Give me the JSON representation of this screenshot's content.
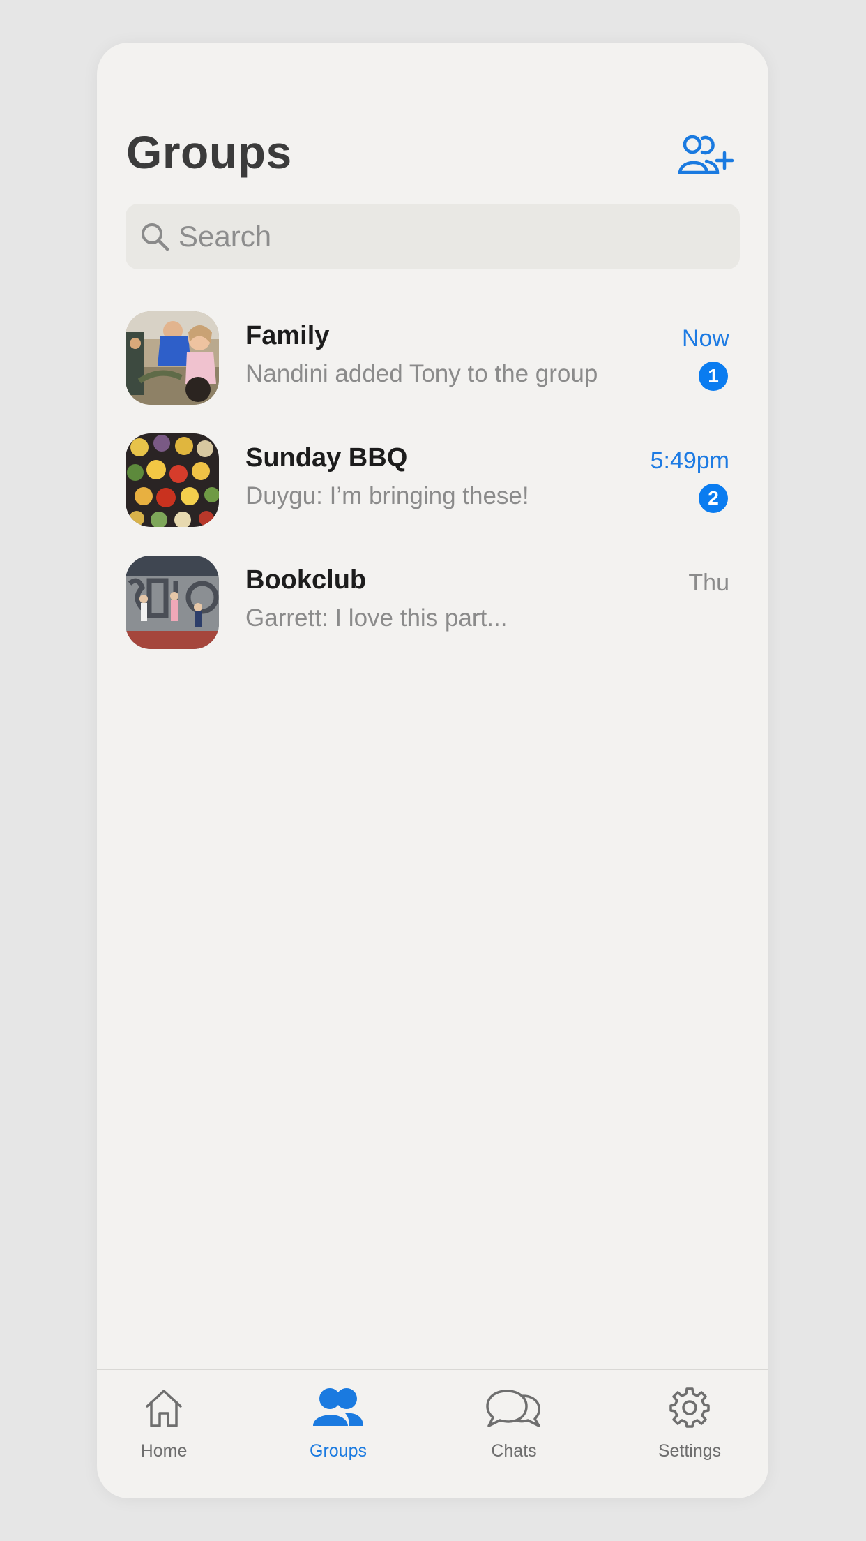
{
  "header": {
    "title": "Groups"
  },
  "search": {
    "placeholder": "Search"
  },
  "groups": [
    {
      "name": "Family",
      "preview": "Nandini added Tony to the group",
      "time": "Now",
      "unread": "1"
    },
    {
      "name": "Sunday BBQ",
      "preview": "Duygu: I’m bringing these!",
      "time": "5:49pm",
      "unread": "2"
    },
    {
      "name": "Bookclub",
      "preview": "Garrett: I love this part...",
      "time": "Thu"
    }
  ],
  "tabs": [
    {
      "label": "Home",
      "icon": "house-icon"
    },
    {
      "label": "Groups",
      "icon": "people-icon",
      "active": true
    },
    {
      "label": "Chats",
      "icon": "chat-bubbles-icon"
    },
    {
      "label": "Settings",
      "icon": "gear-icon"
    }
  ],
  "colors": {
    "accent": "#0a7cf0",
    "background": "#f3f2f0",
    "outer_background": "#e6e6e6",
    "search_background": "#e9e8e4"
  }
}
